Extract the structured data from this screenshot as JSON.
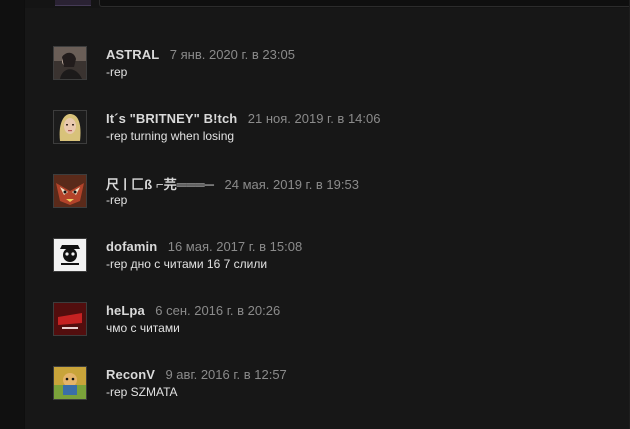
{
  "comments": [
    {
      "author": "ASTRAL",
      "timestamp": "7 янв. 2020 г. в 23:05",
      "text": "-rep",
      "avatar_icon": "avatar-photo-icon"
    },
    {
      "author": "It´s \"BRITNEY\" B!tch",
      "timestamp": "21 ноя. 2019 г. в 14:06",
      "text": "-rep turning when losing",
      "avatar_icon": "avatar-portrait-icon"
    },
    {
      "author": "尺ㅣ匚ß ⌐芫═══─",
      "timestamp": "24 мая. 2019 г. в 19:53",
      "text": "-rep",
      "avatar_icon": "avatar-mask-icon"
    },
    {
      "author": "dofamin",
      "timestamp": "16 мая. 2017 г. в 15:08",
      "text": "-rep дно с читами 16 7 слили",
      "avatar_icon": "avatar-logo-icon"
    },
    {
      "author": "heLpa",
      "timestamp": "6 сен. 2016 г. в 20:26",
      "text": "чмо с читами",
      "avatar_icon": "avatar-red-logo-icon"
    },
    {
      "author": "ReconV",
      "timestamp": "9 авг. 2016 г. в 12:57",
      "text": "-rep SZMATA",
      "avatar_icon": "avatar-cartoon-icon"
    }
  ],
  "colors": {
    "background": "#171717",
    "author": "#d9d9d9",
    "timestamp": "#8b8b8b",
    "text": "#e2e2e2"
  }
}
